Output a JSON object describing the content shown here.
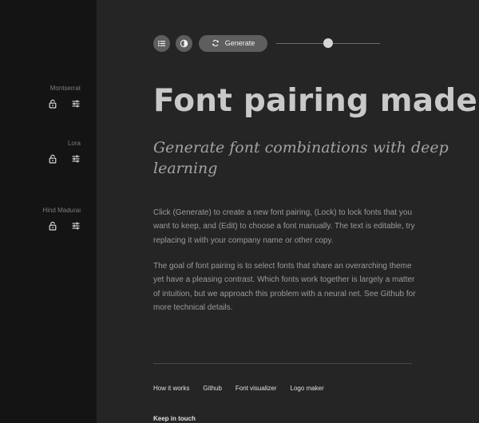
{
  "sidebar": {
    "fonts": [
      {
        "name": "Montserrat",
        "lock_icon": "lock-open-icon",
        "edit_icon": "sliders-icon"
      },
      {
        "name": "Lora",
        "lock_icon": "lock-open-icon",
        "edit_icon": "sliders-icon"
      },
      {
        "name": "Hind Madurai",
        "lock_icon": "lock-open-icon",
        "edit_icon": "sliders-icon"
      }
    ]
  },
  "toolbar": {
    "list_icon": "list-icon",
    "contrast_icon": "contrast-icon",
    "refresh_icon": "refresh-icon",
    "generate_label": "Generate",
    "slider_value": 0.5
  },
  "main": {
    "headline": "Font pairing made simple",
    "subheading": "Generate font combinations with deep learning",
    "paragraphs": [
      "Click (Generate) to create a new font pairing, (Lock) to lock fonts that you want to keep, and (Edit) to choose a font manually. The text is editable, try replacing it with your company name or other copy.",
      "The goal of font pairing is to select fonts that share an overarching theme yet have a pleasing contrast. Which fonts work together is largely a matter of intuition, but we approach this problem with a neural net. See Github for more technical details."
    ]
  },
  "footer": {
    "links": [
      "How it works",
      "Github",
      "Font visualizer",
      "Logo maker"
    ],
    "keep_in_touch": "Keep in touch"
  },
  "colors": {
    "sidebar_bg": "#141414",
    "main_bg": "#252525",
    "button_bg": "#5e5e5e",
    "headline": "#c9c9c9"
  }
}
